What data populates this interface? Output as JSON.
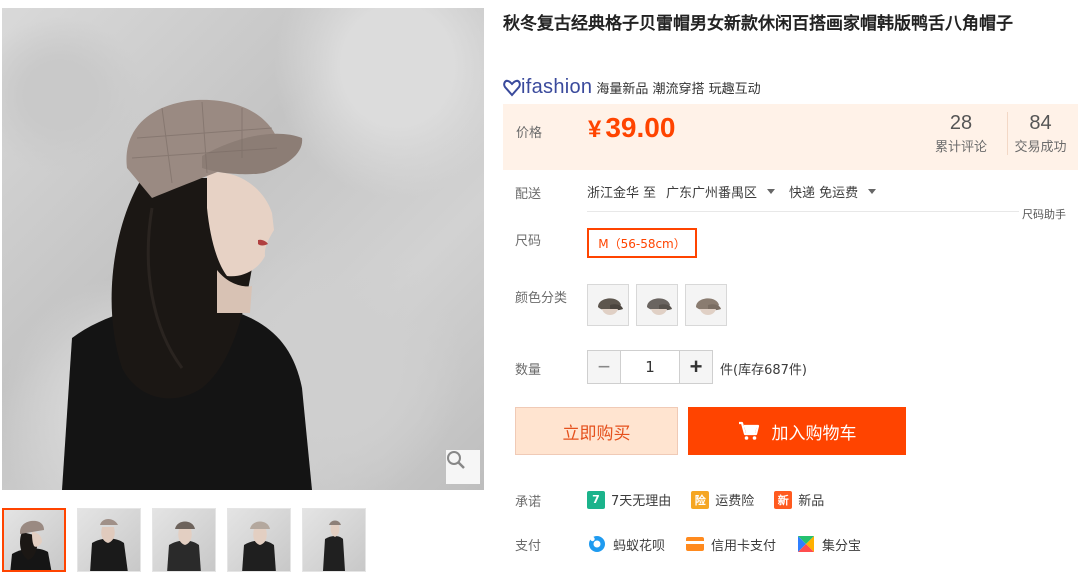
{
  "product": {
    "title": "秋冬复古经典格子贝雷帽男女新款休闲百搭画家帽韩版鸭舌八角帽子",
    "brand_logo": "ifashion",
    "brand_slogan": "海量新品 潮流穿搭 玩趣互动"
  },
  "price": {
    "label": "价格",
    "currency": "¥",
    "value": "39.00",
    "reviews_count": "28",
    "reviews_label": "累计评论",
    "trades_count": "84",
    "trades_label": "交易成功"
  },
  "shipping": {
    "label": "配送",
    "from": "浙江金华",
    "to_word": "至",
    "destination": "广东广州番禺区",
    "method": "快递 免运费"
  },
  "size": {
    "label": "尺码",
    "helper": "尺码助手",
    "selected": "M（56-58cm）"
  },
  "color": {
    "label": "颜色分类"
  },
  "quantity": {
    "label": "数量",
    "minus": "−",
    "value": "1",
    "plus": "+",
    "stock": "件(库存687件)"
  },
  "actions": {
    "buy_now": "立即购买",
    "add_to_cart": "加入购物车"
  },
  "promise": {
    "label": "承诺",
    "items": [
      {
        "icon": "7",
        "text": "7天无理由"
      },
      {
        "icon": "险",
        "text": "运费险"
      },
      {
        "icon": "新",
        "text": "新品"
      }
    ]
  },
  "payment": {
    "label": "支付",
    "items": [
      {
        "text": "蚂蚁花呗"
      },
      {
        "text": "信用卡支付"
      },
      {
        "text": "集分宝"
      }
    ]
  },
  "colors": {
    "accent": "#ff4400",
    "price_bg": "#fff2e8",
    "buy_now_bg": "#ffe4d0",
    "brand": "#3a4a9c"
  }
}
